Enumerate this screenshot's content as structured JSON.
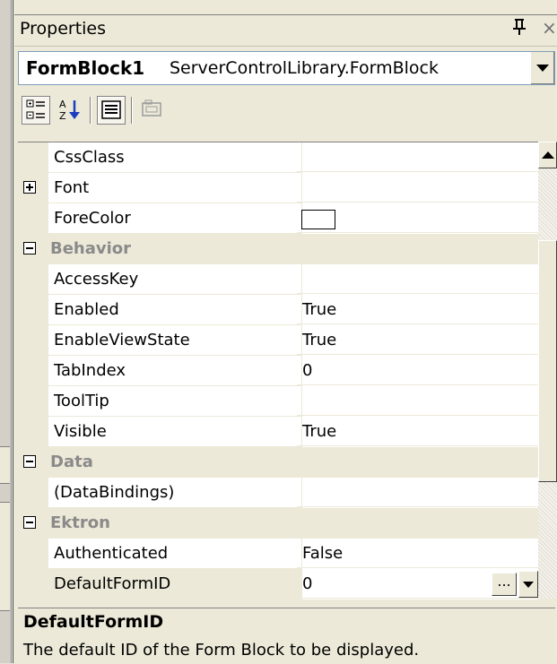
{
  "panel": {
    "title": "Properties",
    "pin_glyph": "т",
    "close_glyph": "×"
  },
  "object_selector": {
    "name": "FormBlock1",
    "type": "ServerControlLibrary.FormBlock"
  },
  "toolbar": {
    "buttons": [
      {
        "icon": "categorized-icon",
        "active": true
      },
      {
        "icon": "alphabetical-icon",
        "active": false
      },
      {
        "icon": "properties-icon",
        "active": true
      },
      {
        "icon": "property-pages-icon",
        "active": false
      }
    ]
  },
  "grid": {
    "rows": [
      {
        "name": "CssClass",
        "value": ""
      },
      {
        "name": "Font",
        "value": "",
        "expand": "plus"
      },
      {
        "name": "ForeColor",
        "value": "",
        "swatch": "#ffffff"
      },
      {
        "category": "Behavior"
      },
      {
        "name": "AccessKey",
        "value": ""
      },
      {
        "name": "Enabled",
        "value": "True"
      },
      {
        "name": "EnableViewState",
        "value": "True"
      },
      {
        "name": "TabIndex",
        "value": "0"
      },
      {
        "name": "ToolTip",
        "value": ""
      },
      {
        "name": "Visible",
        "value": "True"
      },
      {
        "category": "Data"
      },
      {
        "name": "(DataBindings)",
        "value": ""
      },
      {
        "category": "Ektron"
      },
      {
        "name": "Authenticated",
        "value": "False"
      },
      {
        "name": "DefaultFormID",
        "value": "0",
        "selected": true
      }
    ],
    "ellipsis_label": "..."
  },
  "description": {
    "title": "DefaultFormID",
    "text": "The default ID of the Form Block to be displayed."
  }
}
